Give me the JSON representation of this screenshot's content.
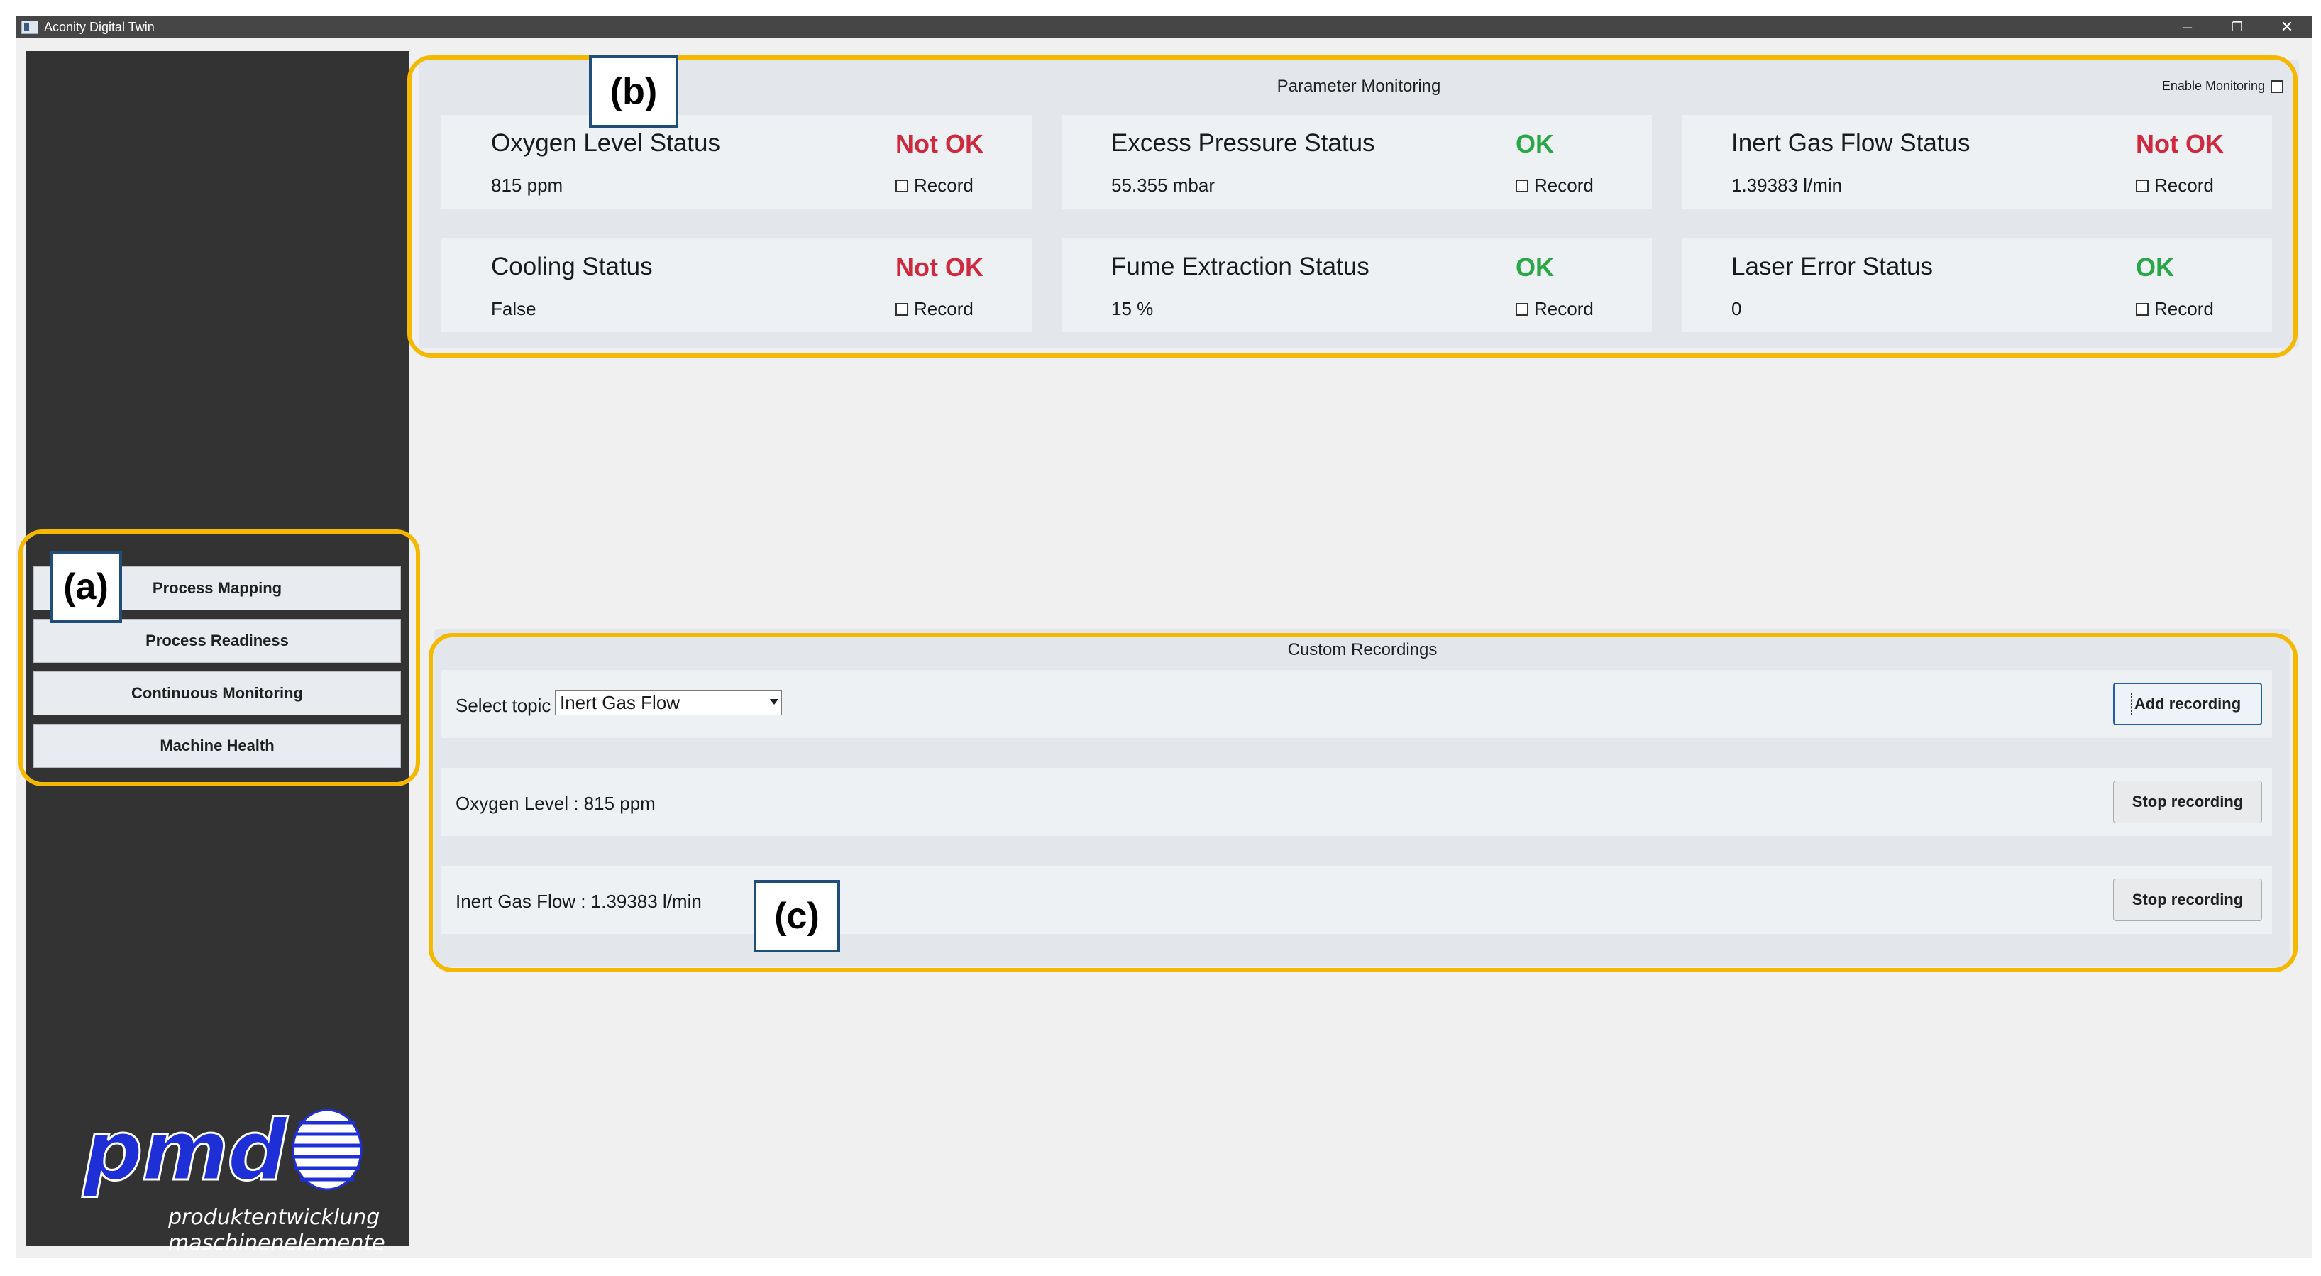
{
  "window": {
    "title": "Aconity Digital Twin",
    "controls": {
      "minimize": "–",
      "restore": "❐",
      "close": "✕"
    }
  },
  "sidebar": {
    "items": [
      {
        "label": "Process Mapping"
      },
      {
        "label": "Process Readiness"
      },
      {
        "label": "Continuous Monitoring"
      },
      {
        "label": "Machine Health"
      }
    ],
    "logo": {
      "text": "pmd",
      "line1": "produktentwicklung",
      "line2": "maschinenelemente"
    }
  },
  "parameter_monitoring": {
    "title": "Parameter Monitoring",
    "enable_label": "Enable Monitoring",
    "record_label": "Record",
    "cards": [
      {
        "name": "Oxygen Level Status",
        "value": "815 ppm",
        "status": "Not OK"
      },
      {
        "name": "Excess Pressure Status",
        "value": "55.355 mbar",
        "status": "OK"
      },
      {
        "name": "Inert Gas Flow Status",
        "value": "1.39383 l/min",
        "status": "Not OK"
      },
      {
        "name": "Cooling Status",
        "value": "False",
        "status": "Not OK"
      },
      {
        "name": "Fume Extraction Status",
        "value": "15 %",
        "status": "OK"
      },
      {
        "name": "Laser Error Status",
        "value": "0",
        "status": "OK"
      }
    ]
  },
  "custom_recordings": {
    "title": "Custom Recordings",
    "select_label": "Select topic",
    "selected_topic": "Inert Gas Flow",
    "add_button": "Add recording",
    "recordings": [
      {
        "label": "Oxygen Level : 815 ppm",
        "button": "Stop recording"
      },
      {
        "label": "Inert Gas Flow : 1.39383 l/min",
        "button": "Stop recording"
      }
    ]
  },
  "annotations": {
    "a": "(a)",
    "b": "(b)",
    "c": "(c)"
  },
  "colors": {
    "ok": "#27a745",
    "not_ok": "#d0283c",
    "highlight": "#f5b800",
    "sidebar": "#333333"
  }
}
